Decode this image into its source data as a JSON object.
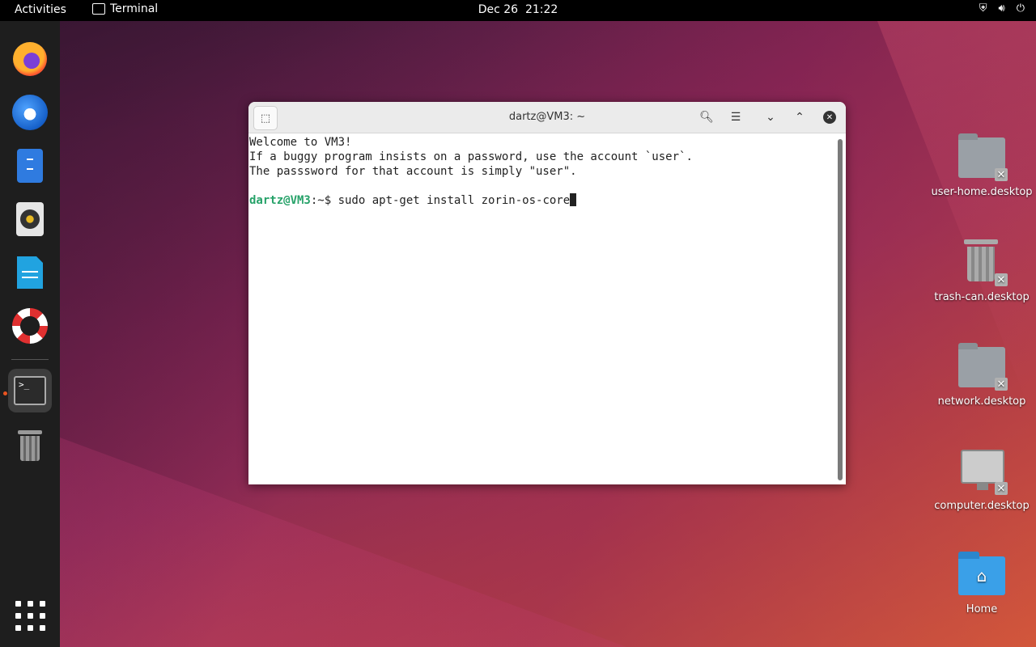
{
  "topbar": {
    "activities": "Activities",
    "app_name": "Terminal",
    "date": "Dec 26",
    "time": "21:22",
    "tray_icons": [
      "shield-icon",
      "volume-icon",
      "power-icon"
    ]
  },
  "dock": {
    "items": [
      {
        "name": "firefox",
        "icon": "firefox-icon"
      },
      {
        "name": "thunderbird",
        "icon": "thunderbird-icon"
      },
      {
        "name": "files",
        "icon": "files-icon"
      },
      {
        "name": "rhythmbox",
        "icon": "rhythmbox-icon"
      },
      {
        "name": "libreoffice-writer",
        "icon": "writer-icon"
      },
      {
        "name": "help",
        "icon": "lifebuoy-icon"
      },
      {
        "name": "terminal",
        "icon": "terminal-icon",
        "active": true
      },
      {
        "name": "trash",
        "icon": "trash-icon"
      }
    ],
    "apps_grid_icon": "app-grid-icon"
  },
  "terminal": {
    "title": "dartz@VM3: ~",
    "lines": [
      "Welcome to VM3!",
      "If a buggy program insists on a password, use the account `user`.",
      "The passsword for that account is simply \"user\"."
    ],
    "prompt_user": "dartz@VM3",
    "prompt_rest": ":~$ ",
    "command": "sudo apt-get install zorin-os-core",
    "prompt_color": "#26a269"
  },
  "desktop": {
    "icons": [
      {
        "label": "user-home.desktop"
      },
      {
        "label": "trash-can.desktop"
      },
      {
        "label": "network.desktop"
      },
      {
        "label": "computer.desktop"
      },
      {
        "label": "Home"
      }
    ]
  },
  "colors": {
    "accent": "#e95420",
    "dock_bg": "#1e1e1e",
    "topbar_bg": "#000000"
  }
}
